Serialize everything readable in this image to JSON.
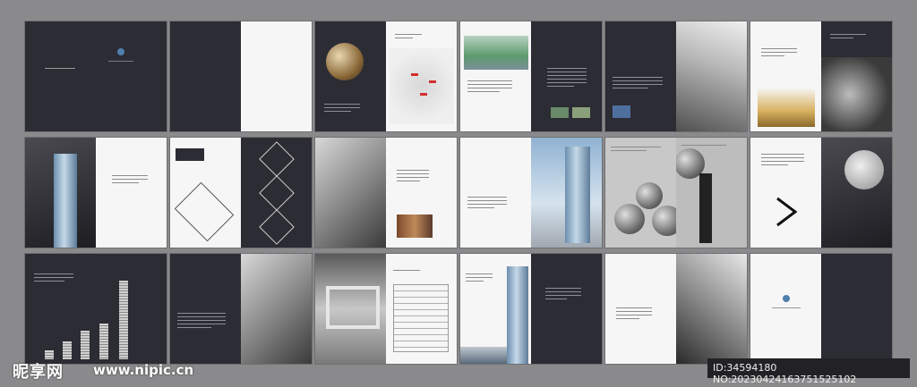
{
  "watermark": {
    "site_logo": "昵享网",
    "url": "www.nipic.cn",
    "id_line": "ID:34594180 NO:20230424163751525102"
  },
  "colors": {
    "background": "#8a8a8c",
    "dark_page": "#2c2c34",
    "white_page": "#f6f6f6",
    "accent_blue": "#4f7fae"
  },
  "spreads": [
    {
      "row": 1,
      "col": 1,
      "left": "dark-cover-back",
      "right": "dark-cover-front-logo"
    },
    {
      "row": 1,
      "col": 2,
      "left": "dark-blank",
      "right": "white-blank"
    },
    {
      "row": 1,
      "col": 3,
      "left": "dark-globe-photo",
      "right": "white-map-with-markers"
    },
    {
      "row": 1,
      "col": 4,
      "left": "white-aerial-photo",
      "right": "dark-text-page"
    },
    {
      "row": 1,
      "col": 5,
      "left": "dark-text-page",
      "right": "white-skyscraper-photo"
    },
    {
      "row": 1,
      "col": 6,
      "left": "white-chess-photo",
      "right": "dark-highway-photo"
    },
    {
      "row": 2,
      "col": 1,
      "left": "dark-tower-photo",
      "right": "white-text-page"
    },
    {
      "row": 2,
      "col": 2,
      "left": "white-floorplan",
      "right": "dark-floorplans"
    },
    {
      "row": 2,
      "col": 3,
      "left": "gray-watch-chart-photo",
      "right": "white-text-page"
    },
    {
      "row": 2,
      "col": 4,
      "left": "white-text-page",
      "right": "sky-tower-photo"
    },
    {
      "row": 2,
      "col": 5,
      "left": "gray-globes-photo",
      "right": "gray-globes-photo-right"
    },
    {
      "row": 2,
      "col": 6,
      "left": "white-arrow-page",
      "right": "dark-dollar-photo"
    },
    {
      "row": 3,
      "col": 1,
      "left": "dark-coins-chart",
      "right": "dark-coins-chart-right"
    },
    {
      "row": 3,
      "col": 2,
      "left": "dark-text-page",
      "right": "gray-chess-photo"
    },
    {
      "row": 3,
      "col": 3,
      "left": "gray-maze-photo",
      "right": "white-table-page"
    },
    {
      "row": 3,
      "col": 4,
      "left": "white-tower-photo",
      "right": "dark-text-page"
    },
    {
      "row": 3,
      "col": 5,
      "left": "white-text-page",
      "right": "gray-skyscraper-photo"
    },
    {
      "row": 3,
      "col": 6,
      "left": "white-back-cover-logo",
      "right": "dark-blank"
    }
  ]
}
